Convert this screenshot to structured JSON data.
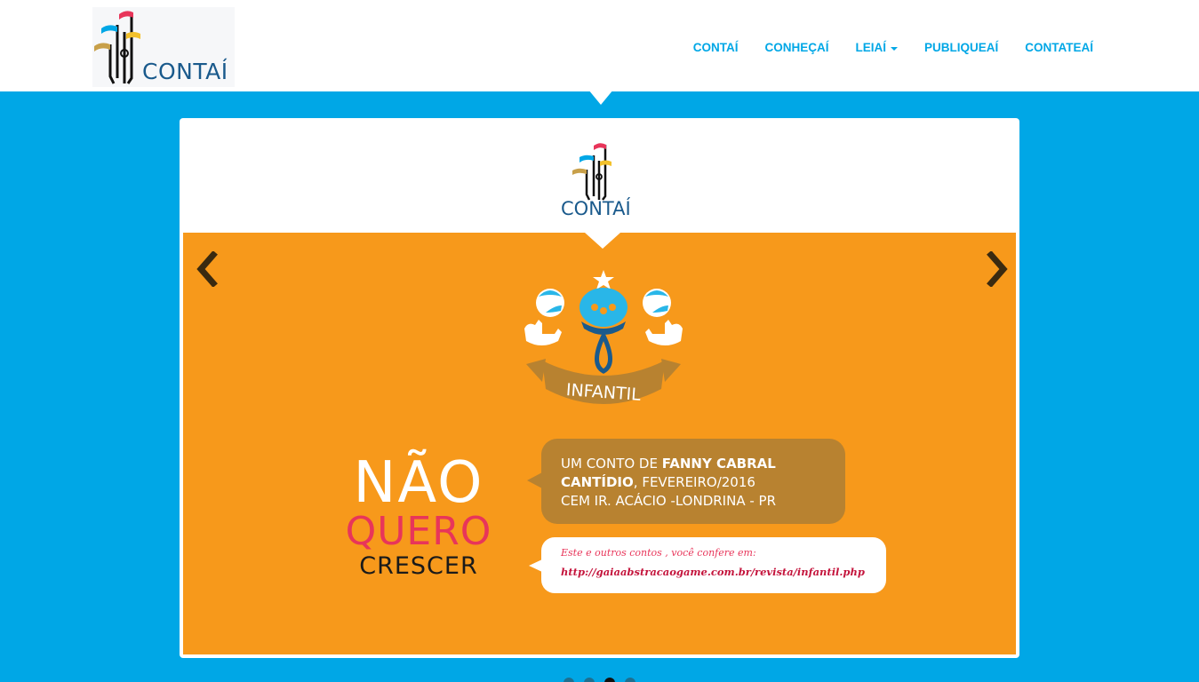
{
  "brand": {
    "name": "CONTAÍ"
  },
  "nav": {
    "items": [
      {
        "label": "CONTAÍ"
      },
      {
        "label": "CONHEÇAÍ"
      },
      {
        "label": "LEIAÍ"
      },
      {
        "label": "PUBLIQUEAÍ"
      },
      {
        "label": "CONTATEAÍ"
      }
    ]
  },
  "card": {
    "logo_text": "CONTAÍ"
  },
  "slide": {
    "badge_label": "INFANTIL",
    "title_line1": "NÃO",
    "title_line2": "QUERO",
    "title_line3": "CRESCER",
    "author_prefix": "UM CONTO DE ",
    "author_name_a": "FANNY CABRAL",
    "author_name_b": "CANTÍDIO",
    "author_date": ", FEVEREIRO/2016",
    "author_school": "CEM IR. ACÁCIO -LONDRINA - PR",
    "link_intro": "Este e outros contos , você confere  em:",
    "link_url": "http://gaiaabstracaogame.com.br/revista/infantil.php"
  },
  "carousel": {
    "slide_count": 4,
    "active_index": 2
  },
  "colors": {
    "page_bg": "#00a7e6",
    "nav_link": "#00a7e6",
    "slide_bg": "#f7991b",
    "accent_red": "#e8355a",
    "brown_bubble": "#b88230"
  },
  "icons": {
    "prev": "chevron-left-icon",
    "next": "chevron-right-icon",
    "caret": "caret-down-icon"
  }
}
